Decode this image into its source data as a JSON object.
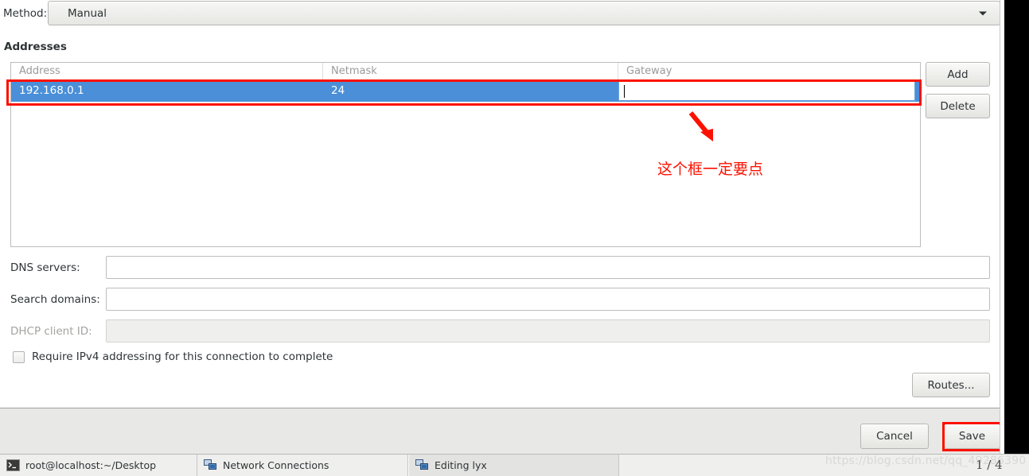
{
  "method": {
    "label": "Method:",
    "value": "Manual",
    "chevron_icon": "chevron-down-icon"
  },
  "addresses": {
    "heading": "Addresses",
    "columns": [
      "Address",
      "Netmask",
      "Gateway"
    ],
    "rows": [
      {
        "address": "192.168.0.1",
        "netmask": "24",
        "gateway": ""
      }
    ],
    "buttons": {
      "add": "Add",
      "delete": "Delete"
    }
  },
  "fields": {
    "dns_label": "DNS servers:",
    "dns_value": "",
    "search_label": "Search domains:",
    "search_value": "",
    "dhcp_label": "DHCP client ID:",
    "dhcp_value": ""
  },
  "checkbox": {
    "label": "Require IPv4 addressing for this connection to complete",
    "checked": false
  },
  "buttons": {
    "routes": "Routes...",
    "cancel": "Cancel",
    "save": "Save"
  },
  "annotations": {
    "note_text": "这个框一定要点",
    "arrow_icon": "down-right-arrow-icon",
    "highlight_color": "#fc1100"
  },
  "taskbar": {
    "items": [
      {
        "label": "root@localhost:~/Desktop",
        "icon": "terminal-icon"
      },
      {
        "label": "Network Connections",
        "icon": "network-icon"
      },
      {
        "label": "Editing lyx",
        "icon": "network-icon"
      }
    ]
  },
  "overlay": {
    "watermark": "https://blog.csdn.net/qq_49286390",
    "page_indicator": "1 / 4"
  },
  "colors": {
    "selection_blue": "#4a8fd8",
    "annotation_red": "#fc1100",
    "bar_gray": "#e8e8e6"
  }
}
